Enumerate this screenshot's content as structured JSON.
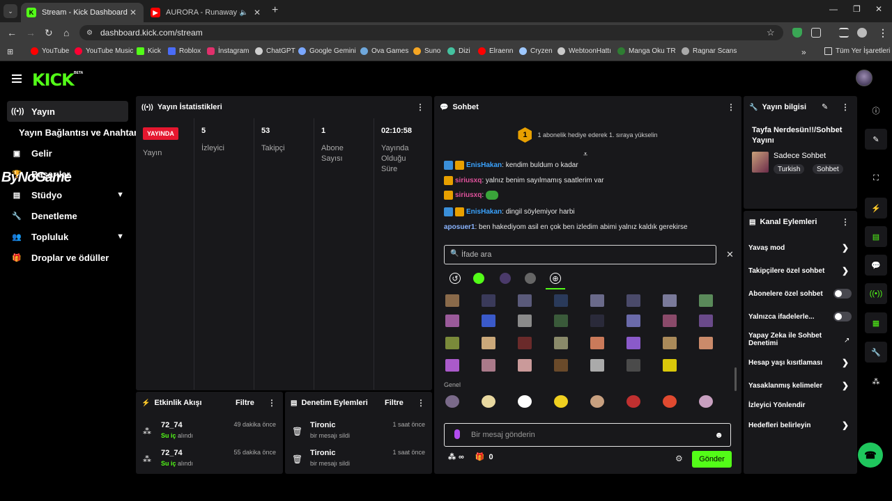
{
  "browser": {
    "tabs": [
      {
        "title": "Stream - Kick Dashboard",
        "icon": "kick-favicon",
        "active": true
      },
      {
        "title": "AURORA - Runaway - YouTu",
        "icon": "youtube-favicon",
        "active": false
      }
    ],
    "url": "dashboard.kick.com/stream",
    "bookmarks": [
      {
        "label": "YouTube",
        "color": "#ff0000"
      },
      {
        "label": "YouTube Music",
        "color": "#ff0033"
      },
      {
        "label": "Kick",
        "color": "#53fc18"
      },
      {
        "label": "Roblox",
        "color": "#4a6cf7"
      },
      {
        "label": "İnstagram",
        "color": "#e1306c"
      },
      {
        "label": "ChatGPT",
        "color": "#cfcfcf"
      },
      {
        "label": "Google Gemini",
        "color": "#7aa7ff"
      },
      {
        "label": "Ova Games",
        "color": "#6fa8dc"
      },
      {
        "label": "Suno",
        "color": "#f5a623"
      },
      {
        "label": "Dizi",
        "color": "#44c2a0"
      },
      {
        "label": "Elraenn",
        "color": "#ff0000"
      },
      {
        "label": "Cryzen",
        "color": "#9ec8ff"
      },
      {
        "label": "WebtoonHattı",
        "color": "#c9c9c9"
      },
      {
        "label": "Manga Oku TR",
        "color": "#2e7d32"
      },
      {
        "label": "Ragnar Scans",
        "color": "#aaaaaa"
      }
    ],
    "bookmarks_more": "»",
    "all_bookmarks": "Tüm Yer İşaretleri"
  },
  "app": {
    "logo": "KICK",
    "beta": "BETA"
  },
  "sidebar": {
    "items": [
      {
        "label": "Yayın",
        "icon": "broadcast-icon"
      },
      {
        "label": "Yayın Bağlantısı ve Anahtarı",
        "icon": "key-icon"
      },
      {
        "label": "Gelir",
        "icon": "wallet-icon"
      },
      {
        "label": "Başarılar",
        "icon": "trophy-icon"
      },
      {
        "label": "Stüdyo",
        "icon": "studio-icon"
      },
      {
        "label": "Denetleme",
        "icon": "wrench-icon"
      },
      {
        "label": "Topluluk",
        "icon": "people-icon"
      },
      {
        "label": "Droplar ve ödüller",
        "icon": "gift-icon"
      }
    ],
    "watermark": "ByNoGame"
  },
  "stats": {
    "title": "Yayın İstatistikleri",
    "live_badge": "YAYINDA",
    "columns": [
      {
        "value": "",
        "label": "Yayın"
      },
      {
        "value": "5",
        "label": "İzleyici"
      },
      {
        "value": "53",
        "label": "Takipçi"
      },
      {
        "value": "1",
        "label": "Abone Sayısı"
      },
      {
        "value": "02:10:58",
        "label": "Yayında Olduğu Süre"
      }
    ]
  },
  "activity": {
    "title": "Etkinlik Akışı",
    "filter": "Filtre",
    "rows": [
      {
        "name": "72_74",
        "highlight": "Su iç",
        "suffix": " alındı",
        "time": "49 dakika önce"
      },
      {
        "name": "72_74",
        "highlight": "Su iç",
        "suffix": " alındı",
        "time": "55 dakika önce"
      }
    ]
  },
  "moderation": {
    "title": "Denetim Eylemleri",
    "filter": "Filtre",
    "rows": [
      {
        "name": "Tironic",
        "detail": "bir mesajı sildi",
        "time": "1 saat önce"
      },
      {
        "name": "Tironic",
        "detail": "bir mesajı sildi",
        "time": "1 saat önce"
      }
    ]
  },
  "chat": {
    "title": "Sohbet",
    "hype_level": "1",
    "hype_text": "1 abonelik hediye ederek 1. sıraya yükselin",
    "messages": [
      {
        "user": "EnisHakan",
        "text": "kendim buldum o kadar"
      },
      {
        "user": "siriusxq",
        "text": "yalnız benim sayılmamış saatlerim var"
      },
      {
        "user": "siriusxq",
        "text": ""
      },
      {
        "user": "EnisHakan",
        "text": "dingil söylemiyor harbi"
      },
      {
        "user": "aposuer1",
        "text": "ben hakediyom asil en çok ben izledim abimi yalnız kaldık gerekirse"
      }
    ],
    "emote_search_placeholder": "İfade ara",
    "emote_section": "Genel",
    "input_placeholder": "Bir mesaj gönderin",
    "infinity": "∞",
    "gift_count": "0",
    "send": "Gönder"
  },
  "stream_info": {
    "title": "Yayın bilgisi",
    "stream_title": "Tayfa Nerdesün!!/Sohbet Yayını",
    "category": "Sadece Sohbet",
    "tags": [
      "Turkish",
      "Sohbet"
    ]
  },
  "channel_actions": {
    "title": "Kanal Eylemleri",
    "items": [
      {
        "label": "Yavaş mod",
        "control": "arrow"
      },
      {
        "label": "Takipçilere özel sohbet",
        "control": "arrow"
      },
      {
        "label": "Abonelere özel sohbet",
        "control": "toggle"
      },
      {
        "label": "Yalnızca ifadelerle...",
        "control": "toggle"
      },
      {
        "label": "Yapay Zeka ile Sohbet Denetimi",
        "control": "external"
      },
      {
        "label": "Hesap yaşı kısıtlaması",
        "control": "arrow"
      },
      {
        "label": "Yasaklanmış kelimeler",
        "control": "arrow"
      },
      {
        "label": "İzleyici Yönlendir",
        "control": "none"
      },
      {
        "label": "Hedefleri belirleyin",
        "control": "arrow"
      }
    ]
  },
  "colors": {
    "kick_green": "#53fc18",
    "live_red": "#e5172f",
    "panel": "#18181b"
  }
}
